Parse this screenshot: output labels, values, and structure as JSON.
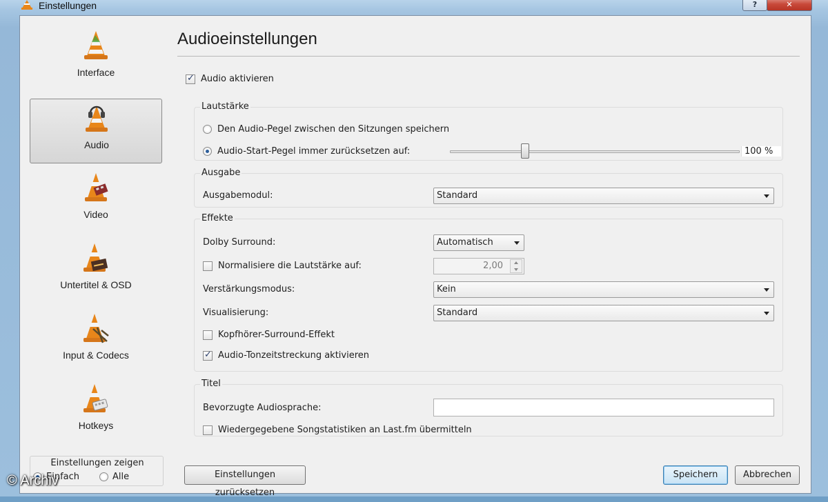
{
  "window": {
    "title": "Einstellungen",
    "help_label": "?",
    "close_label": "✕"
  },
  "sidebar": {
    "items": [
      {
        "label": "Interface",
        "icon": "vlc-cone-icon"
      },
      {
        "label": "Audio",
        "icon": "headphones-cone-icon"
      },
      {
        "label": "Video",
        "icon": "film-cone-icon"
      },
      {
        "label": "Untertitel & OSD",
        "icon": "subtitle-cone-icon"
      },
      {
        "label": "Input & Codecs",
        "icon": "codecs-cone-icon"
      },
      {
        "label": "Hotkeys",
        "icon": "keyboard-cone-icon"
      }
    ],
    "selected": "Audio",
    "show_settings": {
      "title": "Einstellungen zeigen",
      "options": [
        "Einfach",
        "Alle"
      ],
      "selected": "Einfach"
    }
  },
  "main": {
    "title": "Audioeinstellungen",
    "enable_audio": {
      "label": "Audio aktivieren",
      "checked": true
    },
    "volume": {
      "title": "Lautstärke",
      "save_level_label": "Den Audio-Pegel zwischen den Sitzungen speichern",
      "reset_level_label": "Audio-Start-Pegel immer zurücksetzen auf:",
      "selected": "reset",
      "level_fraction": 0.26,
      "level_text": "100 %"
    },
    "output": {
      "title": "Ausgabe",
      "module_label": "Ausgabemodul:",
      "module_value": "Standard"
    },
    "effects": {
      "title": "Effekte",
      "dolby_label": "Dolby Surround:",
      "dolby_value": "Automatisch",
      "normalize_label": "Normalisiere die Lautstärke auf:",
      "normalize_checked": false,
      "normalize_value": "2,00",
      "gain_label": "Verstärkungsmodus:",
      "gain_value": "Kein",
      "visual_label": "Visualisierung:",
      "visual_value": "Standard",
      "headphone_label": "Kopfhörer-Surround-Effekt",
      "headphone_checked": false,
      "timestretch_label": "Audio-Tonzeitstreckung aktivieren",
      "timestretch_checked": true
    },
    "track": {
      "title": "Titel",
      "lang_label": "Bevorzugte Audiosprache:",
      "lang_value": "",
      "lastfm_label": "Wiedergegebene Songstatistiken an Last.fm übermitteln",
      "lastfm_checked": false
    }
  },
  "footer": {
    "reset_label": "Einstellungen zurücksetzen",
    "save_label": "Speichern",
    "cancel_label": "Abbrechen"
  },
  "watermark": "© Archiv",
  "colors": {
    "cone_orange": "#e8861a",
    "cone_white": "#f4f4f4",
    "selection_border": "#8a8a8a",
    "default_button": "#3c7fb1"
  }
}
